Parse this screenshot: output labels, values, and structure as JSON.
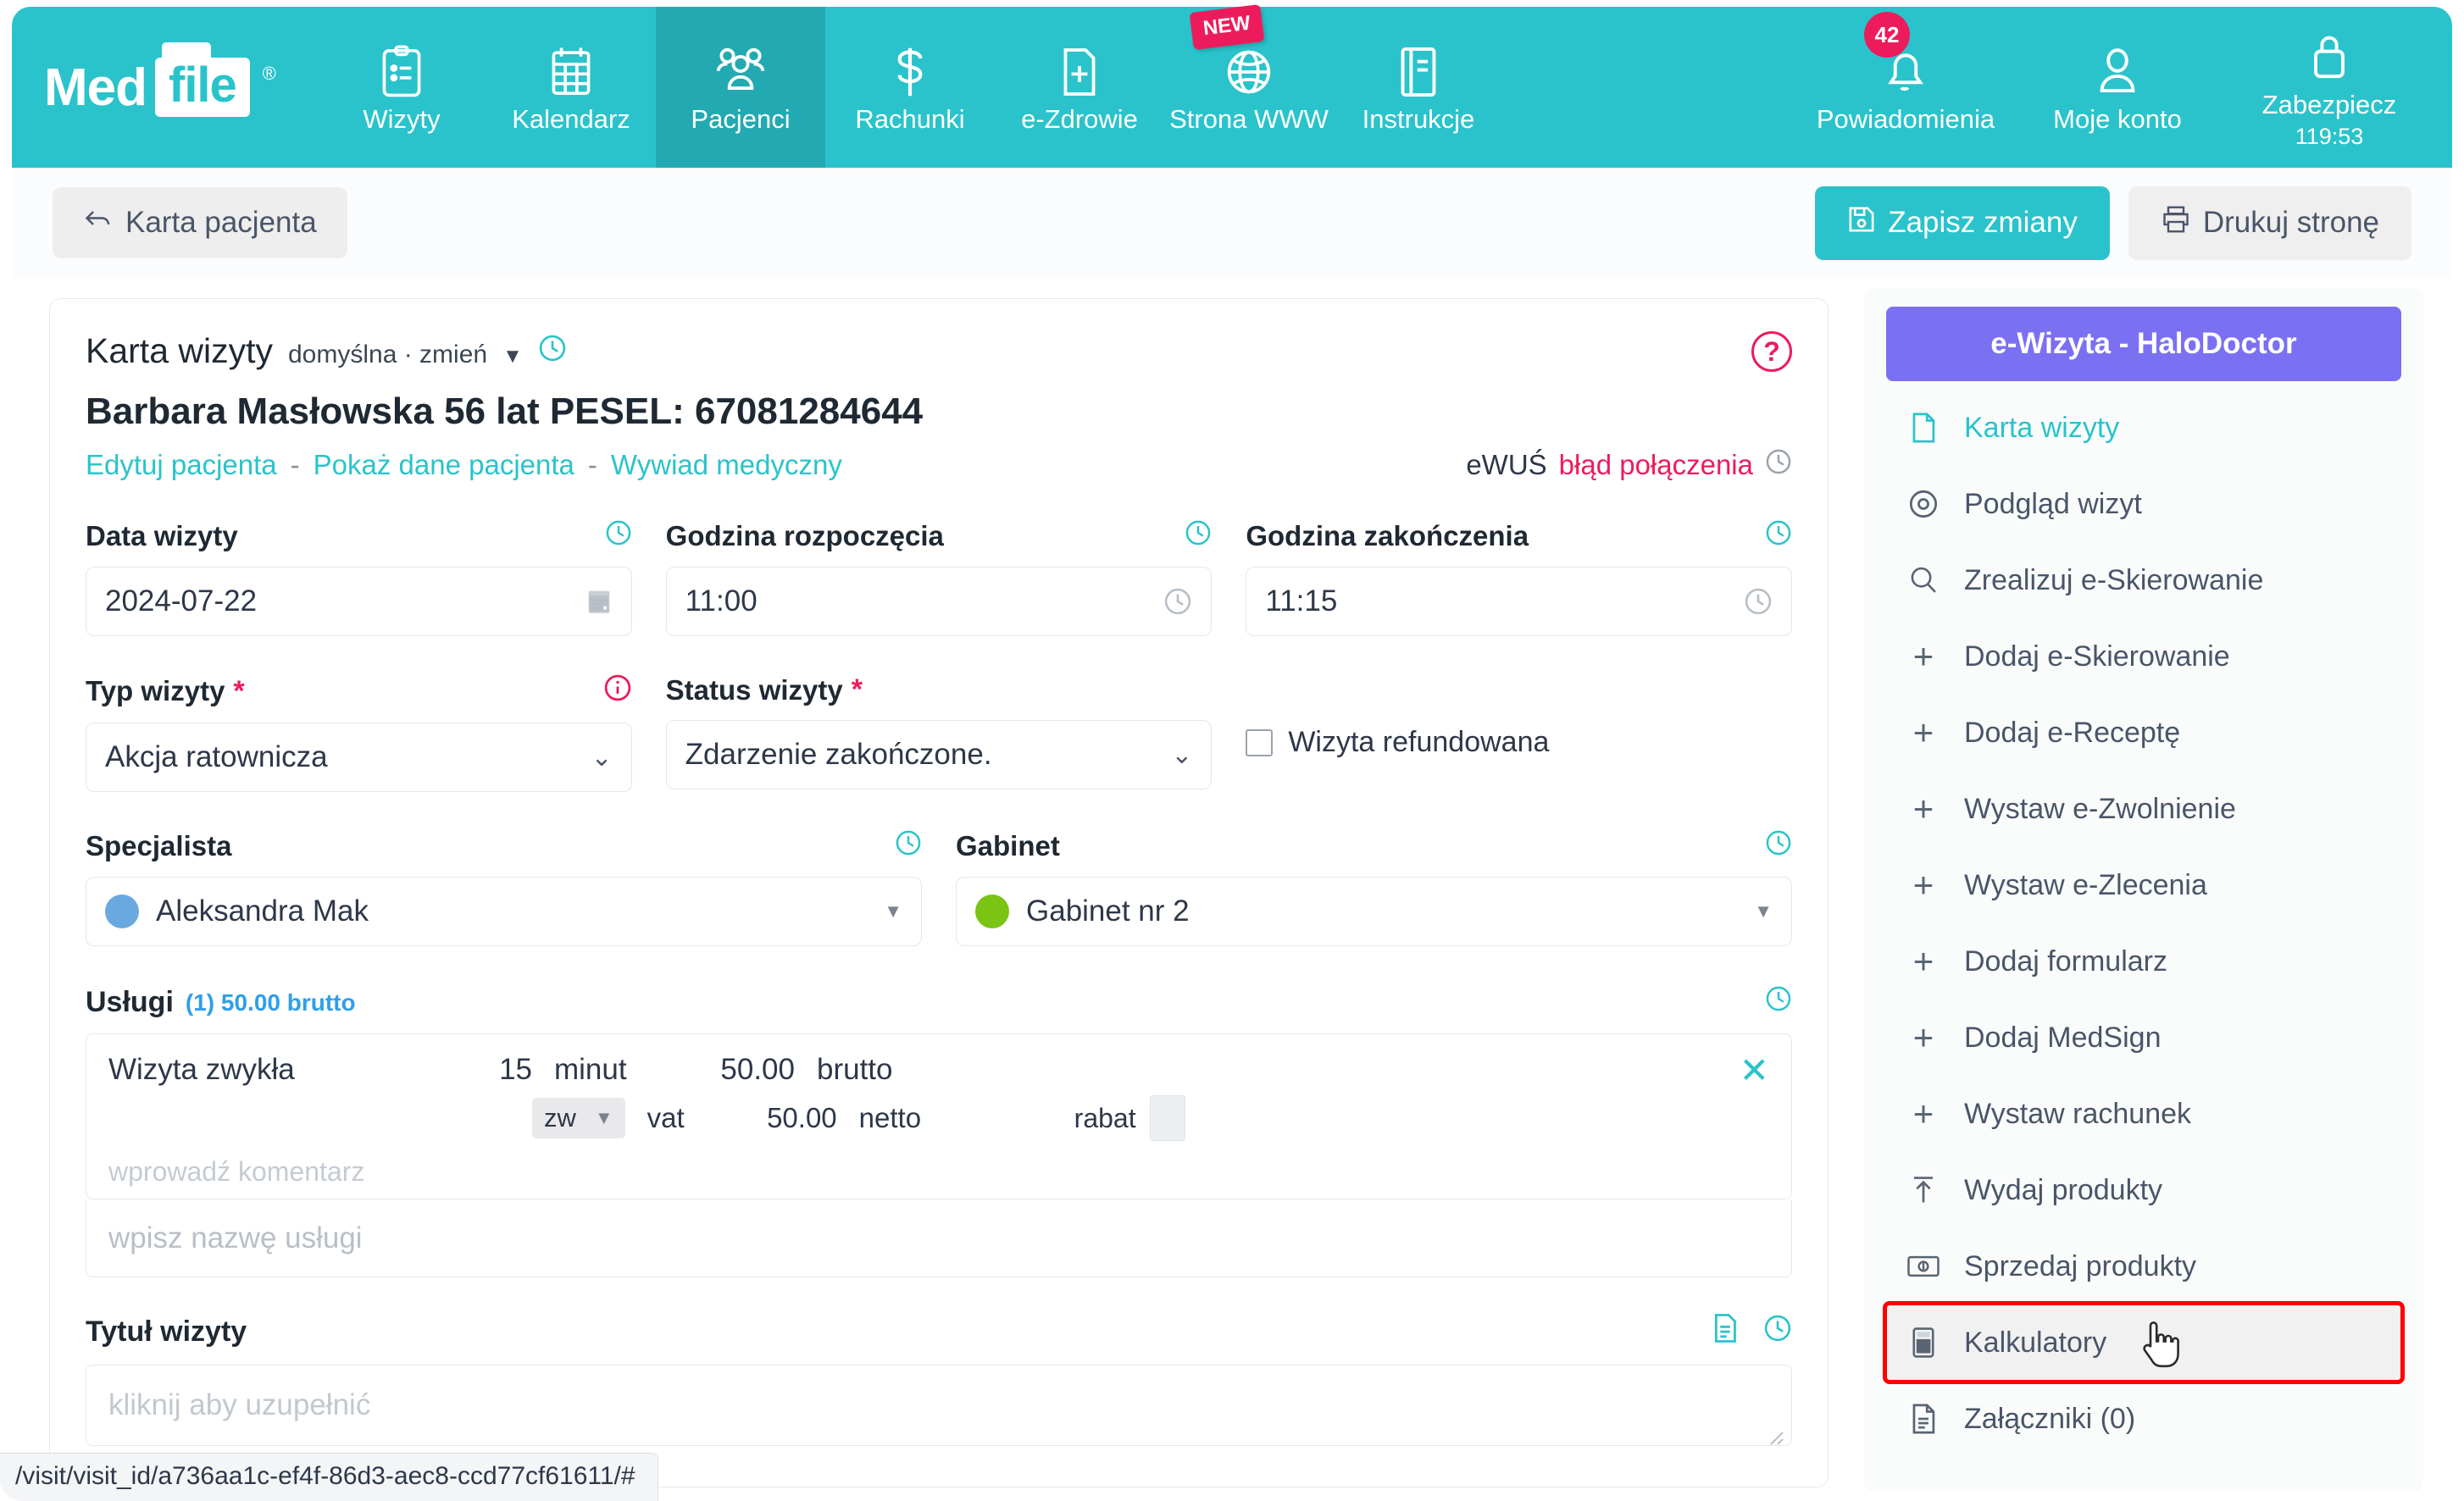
{
  "topnav": {
    "logo": {
      "med": "Med",
      "file": "file",
      "registered": "®"
    },
    "items": [
      {
        "label": "Wizyty",
        "icon": "clipboard-icon",
        "active": false
      },
      {
        "label": "Kalendarz",
        "icon": "calendar-icon",
        "active": false
      },
      {
        "label": "Pacjenci",
        "icon": "people-icon",
        "active": true
      },
      {
        "label": "Rachunki",
        "icon": "dollar-icon",
        "active": false
      },
      {
        "label": "e-Zdrowie",
        "icon": "medical-file-icon",
        "active": false
      },
      {
        "label": "Strona WWW",
        "icon": "globe-icon",
        "active": false,
        "tag": "NEW"
      },
      {
        "label": "Instrukcje",
        "icon": "book-icon",
        "active": false
      }
    ],
    "right_items": [
      {
        "label": "Powiadomienia",
        "icon": "bell-icon",
        "badge": "42"
      },
      {
        "label": "Moje konto",
        "icon": "user-icon"
      },
      {
        "label": "Zabezpiecz",
        "icon": "lock-icon",
        "timer": "119:53"
      }
    ]
  },
  "toolbar": {
    "back_label": "Karta pacjenta",
    "save_label": "Zapisz zmiany",
    "print_label": "Drukuj stronę"
  },
  "card": {
    "title": "Karta wizyty",
    "template_label": "domyślna · zmień",
    "patient_line": "Barbara Masłowska 56 lat PESEL: 67081284644",
    "links": [
      "Edytuj pacjenta",
      "Pokaż dane pacjenta",
      "Wywiad medyczny"
    ],
    "link_sep": "-",
    "ewus_label": "eWUŚ",
    "ewus_status": "błąd połączenia",
    "help": "?",
    "fields": {
      "date_label": "Data wizyty",
      "date_value": "2024-07-22",
      "start_label": "Godzina rozpoczęcia",
      "start_value": "11:00",
      "end_label": "Godzina zakończenia",
      "end_value": "11:15",
      "type_label": "Typ wizyty",
      "type_value": "Akcja ratownicza",
      "status_label": "Status wizyty",
      "status_value": "Zdarzenie zakończone.",
      "refunded_label": "Wizyta refundowana",
      "specialist_label": "Specjalista",
      "specialist_value": "Aleksandra Mak",
      "room_label": "Gabinet",
      "room_value": "Gabinet nr 2",
      "required_star": "*"
    },
    "services": {
      "title": "Usługi",
      "summary": "(1) 50.00 brutto",
      "row": {
        "name": "Wizyta zwykła",
        "duration": "15",
        "duration_unit": "minut",
        "gross_price": "50.00",
        "gross_label": "brutto",
        "vat_value": "zw",
        "vat_label": "vat",
        "net_price": "50.00",
        "net_label": "netto",
        "discount_label": "rabat",
        "comment_placeholder": "wprowadź komentarz",
        "remove": "✕"
      },
      "add_placeholder": "wpisz nazwę usługi"
    },
    "visit_title": {
      "label": "Tytuł wizyty",
      "placeholder": "kliknij aby uzupełnić"
    }
  },
  "statusbar": {
    "url": "/visit/visit_id/a736aa1c-ef4f-86d3-aec8-ccd77cf61611/#"
  },
  "rpanel": {
    "ewizyta_label": "e-Wizyta - HaloDoctor",
    "items": [
      {
        "label": "Karta wizyty",
        "icon": "document-icon",
        "style": "teal"
      },
      {
        "label": "Podgląd wizyt",
        "icon": "eye-icon",
        "style": "normal"
      },
      {
        "label": "Zrealizuj e-Skierowanie",
        "icon": "search-icon",
        "style": "normal"
      },
      {
        "label": "Dodaj e-Skierowanie",
        "icon": "plus-icon",
        "style": "normal"
      },
      {
        "label": "Dodaj e-Receptę",
        "icon": "plus-icon",
        "style": "normal"
      },
      {
        "label": "Wystaw e-Zwolnienie",
        "icon": "plus-icon",
        "style": "normal"
      },
      {
        "label": "Wystaw e-Zlecenia",
        "icon": "plus-icon",
        "style": "normal"
      },
      {
        "label": "Dodaj formularz",
        "icon": "plus-icon",
        "style": "normal"
      },
      {
        "label": "Dodaj MedSign",
        "icon": "plus-icon",
        "style": "normal"
      },
      {
        "label": "Wystaw rachunek",
        "icon": "plus-icon",
        "style": "normal"
      },
      {
        "label": "Wydaj produkty",
        "icon": "upload-arrow-icon",
        "style": "normal"
      },
      {
        "label": "Sprzedaj produkty",
        "icon": "banknote-icon",
        "style": "normal"
      },
      {
        "label": "Kalkulatory",
        "icon": "calculator-icon",
        "style": "highlight"
      },
      {
        "label": "Załączniki (0)",
        "icon": "attachment-doc-icon",
        "style": "normal"
      }
    ]
  },
  "colors": {
    "brand_teal": "#2ac3cb",
    "brand_teal_dark": "#22a9b1",
    "accent_pink": "#ec1c5c",
    "ewizyta_purple": "#7b70f2",
    "highlight_red": "#ff0000",
    "specialist_dot": "#6aa9e0",
    "room_dot": "#7ac414"
  }
}
